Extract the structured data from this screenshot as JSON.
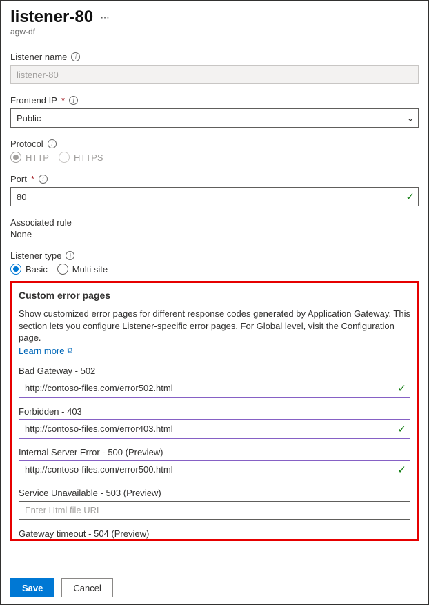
{
  "header": {
    "title": "listener-80",
    "subtitle": "agw-df"
  },
  "listener_name": {
    "label": "Listener name",
    "value": "listener-80"
  },
  "frontend_ip": {
    "label": "Frontend IP",
    "value": "Public"
  },
  "protocol": {
    "label": "Protocol",
    "options": {
      "http": "HTTP",
      "https": "HTTPS"
    },
    "selected": "http"
  },
  "port": {
    "label": "Port",
    "value": "80"
  },
  "associated_rule": {
    "label": "Associated rule",
    "value": "None"
  },
  "listener_type": {
    "label": "Listener type",
    "options": {
      "basic": "Basic",
      "multi": "Multi site"
    },
    "selected": "basic"
  },
  "custom_error": {
    "heading": "Custom error pages",
    "description": "Show customized error pages for different response codes generated by Application Gateway. This section lets you configure Listener-specific error pages. For Global level, visit the Configuration page.",
    "learn_more": "Learn more",
    "placeholder": "Enter Html file URL",
    "fields": [
      {
        "label": "Bad Gateway - 502",
        "value": "http://contoso-files.com/error502.html",
        "filled": true
      },
      {
        "label": "Forbidden - 403",
        "value": "http://contoso-files.com/error403.html",
        "filled": true
      },
      {
        "label": "Internal Server Error - 500 (Preview)",
        "value": "http://contoso-files.com/error500.html",
        "filled": true
      },
      {
        "label": "Service Unavailable - 503 (Preview)",
        "value": "",
        "filled": false
      },
      {
        "label": "Gateway timeout - 504 (Preview)",
        "value": "",
        "filled": false
      }
    ]
  },
  "footer": {
    "save": "Save",
    "cancel": "Cancel"
  }
}
